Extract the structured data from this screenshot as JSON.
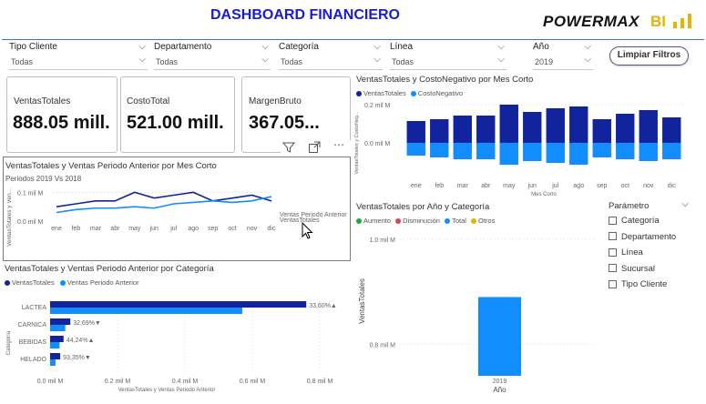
{
  "header": {
    "title": "DASHBOARD FINANCIERO",
    "logo_text": "POWERMAX",
    "logo_bi": "BI"
  },
  "slicers": [
    {
      "label": "Tipo Cliente",
      "value": "Todas"
    },
    {
      "label": "Departamento",
      "value": "Todas"
    },
    {
      "label": "Categoría",
      "value": "Todas"
    },
    {
      "label": "Línea",
      "value": "Todas"
    },
    {
      "label": "Año",
      "value": "2019"
    }
  ],
  "clear_button": "Limpiar Filtros",
  "cards": [
    {
      "label": "VentasTotales",
      "value": "888.05 mill."
    },
    {
      "label": "CostoTotal",
      "value": "521.00 mill."
    },
    {
      "label": "MargenBruto",
      "value": "367.05..."
    }
  ],
  "line_chart": {
    "title": "VentasTotales y Ventas Periodo Anterior por Mes Corto",
    "subtitle": "Periodos 2019 Vs 2018",
    "ylabel": "VentasTotales y Ven...",
    "y_ticks": [
      "0.1 mil M",
      "0.0 mil M"
    ],
    "series_labels": [
      "Ventas Periodo Anterior",
      "VentasTotales"
    ],
    "colors": {
      "current": "#12239e",
      "previous": "#118dff"
    }
  },
  "bar_chart": {
    "title": "VentasTotales y CostoNegativo por Mes Corto",
    "legend": [
      "VentasTotales",
      "CostoNegativo"
    ],
    "ylabel": "VentasTotales y CostoNeg...",
    "xlabel": "Mes Corto",
    "y_ticks": [
      "0.2 mil M",
      "0.0 mil M"
    ]
  },
  "hbar_chart": {
    "title": "VentasTotales y Ventas Periodo Anterior por Categoría",
    "legend": [
      "VentasTotales",
      "Ventas Periodo Anterior"
    ],
    "ylabel": "Categoría",
    "xlabel": "VentasTotales y Ventas Periodo Anterior",
    "x_ticks": [
      "0.0 mil M",
      "0.2 mil M",
      "0.4 mil M",
      "0.6 mil M",
      "0.8 mil M"
    ]
  },
  "waterfall": {
    "title": "VentasTotales por Año y Categoría",
    "legend": [
      "Aumento",
      "Disminución",
      "Total",
      "Otros"
    ],
    "legend_colors": [
      "#1aab40",
      "#d64550",
      "#118dff",
      "#e8b400"
    ],
    "ylabel": "VentasTotales",
    "xlabel": "Año",
    "y_ticks": [
      "1.0 mil M",
      "0.8 mil M"
    ],
    "x_ticks": [
      "2019"
    ]
  },
  "parametro": {
    "title": "Parámetro",
    "items": [
      "Categoría",
      "Departamento",
      "Línea",
      "Sucursal",
      "Tipo Cliente"
    ]
  },
  "chart_data": [
    {
      "type": "line",
      "title": "VentasTotales y Ventas Periodo Anterior por Mes Corto",
      "subtitle": "Periodos 2019 Vs 2018",
      "categories": [
        "ene",
        "feb",
        "mar",
        "abr",
        "may",
        "jun",
        "jul",
        "ago",
        "sep",
        "oct",
        "nov",
        "dic"
      ],
      "series": [
        {
          "name": "VentasTotales",
          "values": [
            0.05,
            0.06,
            0.07,
            0.07,
            0.1,
            0.08,
            0.09,
            0.1,
            0.07,
            0.08,
            0.09,
            0.07
          ]
        },
        {
          "name": "Ventas Periodo Anterior",
          "values": [
            0.03,
            0.04,
            0.045,
            0.045,
            0.05,
            0.045,
            0.06,
            0.065,
            0.07,
            0.065,
            0.07,
            0.085
          ]
        }
      ],
      "ylim": [
        0,
        0.12
      ]
    },
    {
      "type": "bar",
      "title": "VentasTotales y CostoNegativo por Mes Corto",
      "categories": [
        "ene",
        "feb",
        "mar",
        "abr",
        "may",
        "jun",
        "jul",
        "ago",
        "sep",
        "oct",
        "nov",
        "dic"
      ],
      "series": [
        {
          "name": "VentasTotales",
          "values": [
            0.06,
            0.065,
            0.075,
            0.075,
            0.105,
            0.085,
            0.095,
            0.1,
            0.065,
            0.08,
            0.09,
            0.07
          ]
        },
        {
          "name": "CostoNegativo",
          "values": [
            -0.035,
            -0.04,
            -0.045,
            -0.045,
            -0.06,
            -0.05,
            -0.055,
            -0.06,
            -0.04,
            -0.045,
            -0.05,
            -0.045
          ]
        }
      ],
      "ylim": [
        -0.08,
        0.2
      ]
    },
    {
      "type": "bar",
      "orientation": "horizontal",
      "title": "VentasTotales y Ventas Periodo Anterior por Categoría",
      "categories": [
        "LACTEA",
        "CARNICA",
        "BEBIDAS",
        "HELADO"
      ],
      "series": [
        {
          "name": "VentasTotales",
          "values": [
            0.76,
            0.06,
            0.04,
            0.03
          ]
        },
        {
          "name": "Ventas Periodo Anterior",
          "values": [
            0.57,
            0.045,
            0.028,
            0.016
          ]
        }
      ],
      "data_labels": [
        "33,60%▲",
        "32,69%▼",
        "44,24%▲",
        "93,35%▼"
      ],
      "xlim": [
        0,
        0.8
      ]
    },
    {
      "type": "bar",
      "title": "VentasTotales por Año y Categoría",
      "categories": [
        "2019"
      ],
      "values": [
        0.89
      ],
      "ylim": [
        0.74,
        1.0
      ]
    }
  ]
}
